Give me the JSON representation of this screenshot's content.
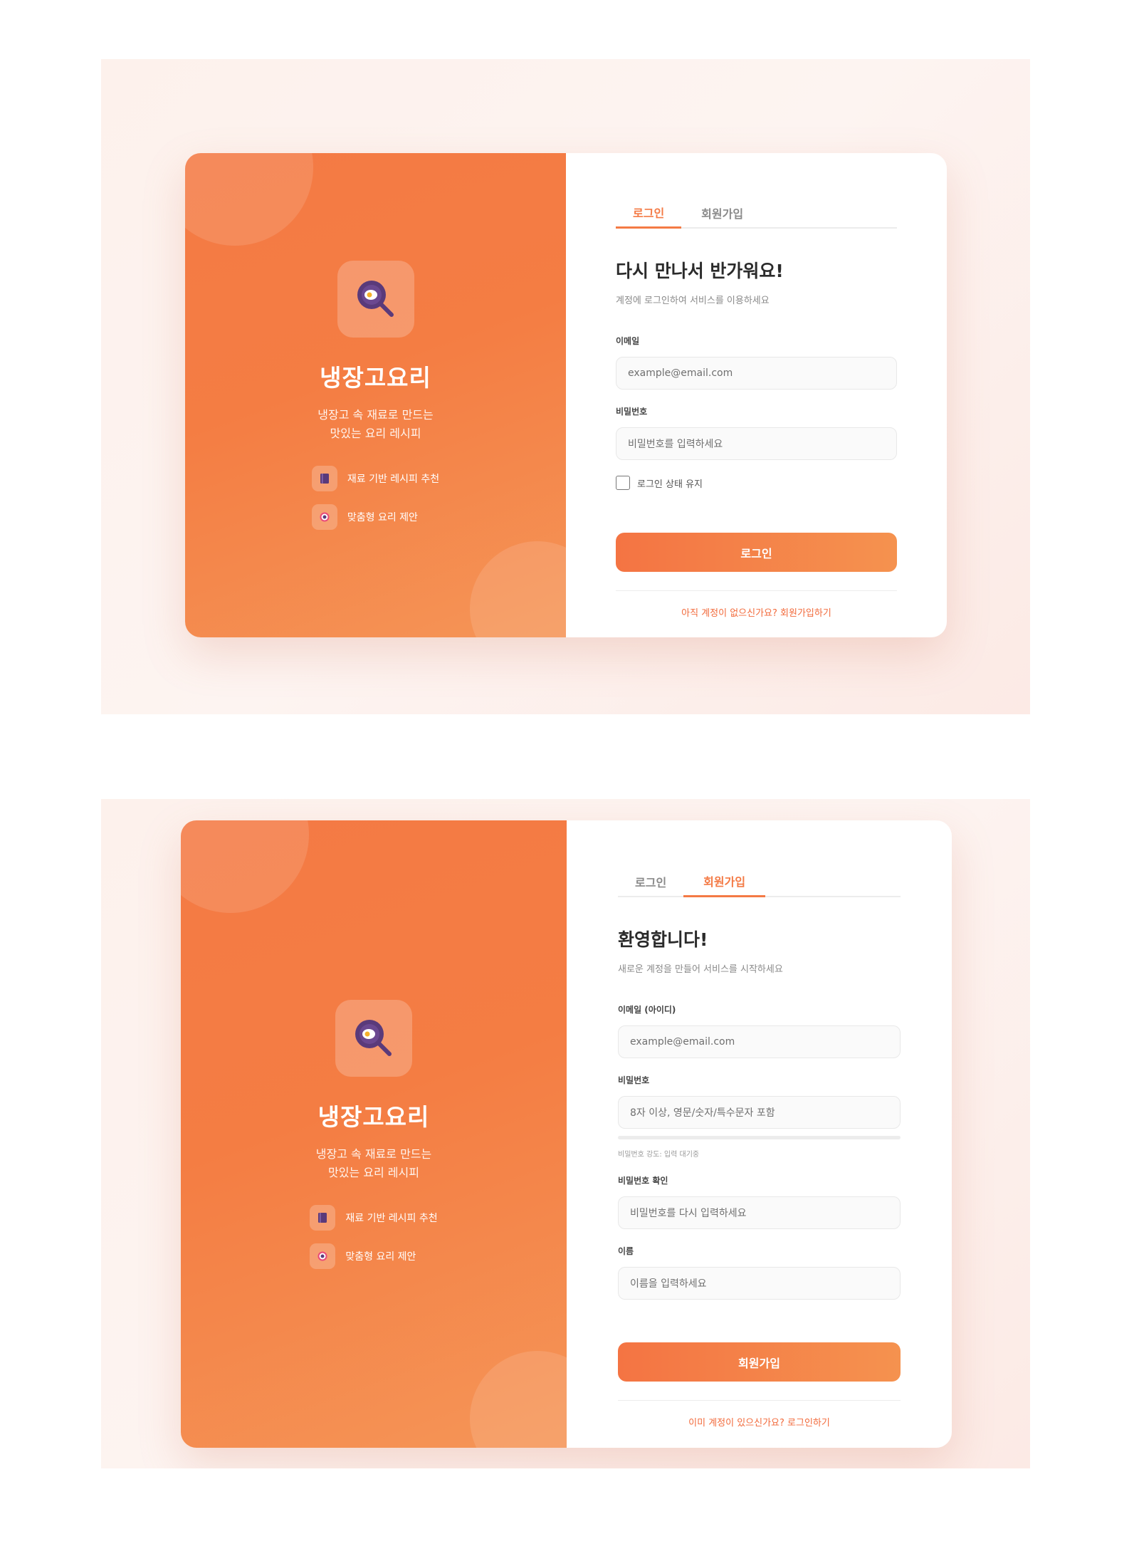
{
  "brand": {
    "name": "냉장고요리",
    "tagline_line1": "냉장고 속 재료로 만드는",
    "tagline_line2": "맛있는 요리 레시피",
    "features": [
      {
        "icon": "book-icon",
        "label": "재료 기반 레시피 추천"
      },
      {
        "icon": "target-icon",
        "label": "맞춤형 요리 제안"
      }
    ]
  },
  "colors": {
    "accent": "#f47a45",
    "link": "#f26a3b",
    "icon_purple": "#5a3a7a"
  },
  "login": {
    "tabs": [
      {
        "label": "로그인",
        "active": true
      },
      {
        "label": "회원가입",
        "active": false
      }
    ],
    "title": "다시 만나서 반가워요!",
    "subtitle": "계정에 로그인하여 서비스를 이용하세요",
    "email": {
      "label": "이메일",
      "placeholder": "example@email.com"
    },
    "password": {
      "label": "비밀번호",
      "placeholder": "비밀번호를 입력하세요"
    },
    "remember": {
      "label": "로그인 상태 유지",
      "checked": false
    },
    "submit": "로그인",
    "footer_link": "아직 계정이 없으신가요? 회원가입하기"
  },
  "signup": {
    "tabs": [
      {
        "label": "로그인",
        "active": false
      },
      {
        "label": "회원가입",
        "active": true
      }
    ],
    "title": "환영합니다!",
    "subtitle": "새로운 계정을 만들어 서비스를 시작하세요",
    "email": {
      "label": "이메일 (아이디)",
      "placeholder": "example@email.com"
    },
    "password": {
      "label": "비밀번호",
      "placeholder": "8자 이상, 영문/숫자/특수문자 포함"
    },
    "strength": "비밀번호 강도: 입력 대기중",
    "confirm": {
      "label": "비밀번호 확인",
      "placeholder": "비밀번호를 다시 입력하세요"
    },
    "name": {
      "label": "이름",
      "placeholder": "이름을 입력하세요"
    },
    "submit": "회원가입",
    "footer_link": "이미 계정이 있으신가요? 로그인하기"
  }
}
